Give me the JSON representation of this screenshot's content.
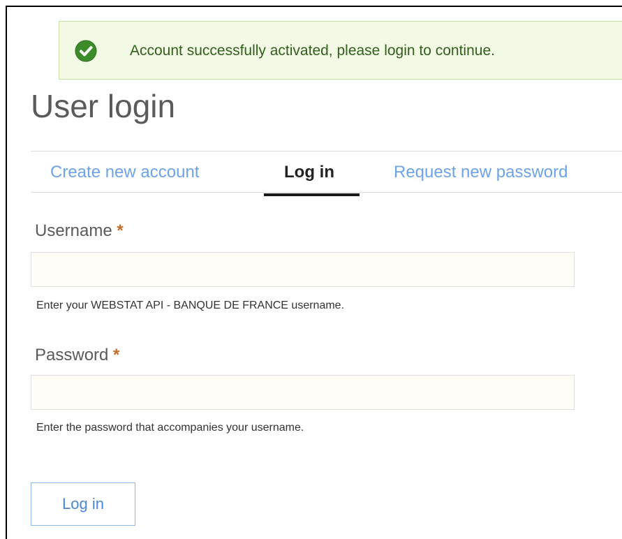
{
  "status": {
    "type": "success",
    "icon": "check-circle-icon",
    "message": "Account successfully activated, please login to continue.",
    "colors": {
      "background": "#f2f9e5",
      "border": "#c9e1a5",
      "icon": "#3d8c2a",
      "text": "#325e1c"
    }
  },
  "page": {
    "title": "User login"
  },
  "tabs": [
    {
      "label": "Create new account",
      "active": false
    },
    {
      "label": "Log in",
      "active": true
    },
    {
      "label": "Request new password",
      "active": false
    }
  ],
  "form": {
    "username": {
      "label": "Username",
      "required_marker": "*",
      "value": "",
      "description": "Enter your WEBSTAT API - BANQUE DE FRANCE username."
    },
    "password": {
      "label": "Password",
      "required_marker": "*",
      "value": "",
      "description": "Enter the password that accompanies your username."
    },
    "submit_label": "Log in"
  },
  "colors": {
    "link": "#6da3e8",
    "required": "#c76b2b",
    "button_border": "#8cb5ea",
    "button_text": "#4a86d8"
  }
}
